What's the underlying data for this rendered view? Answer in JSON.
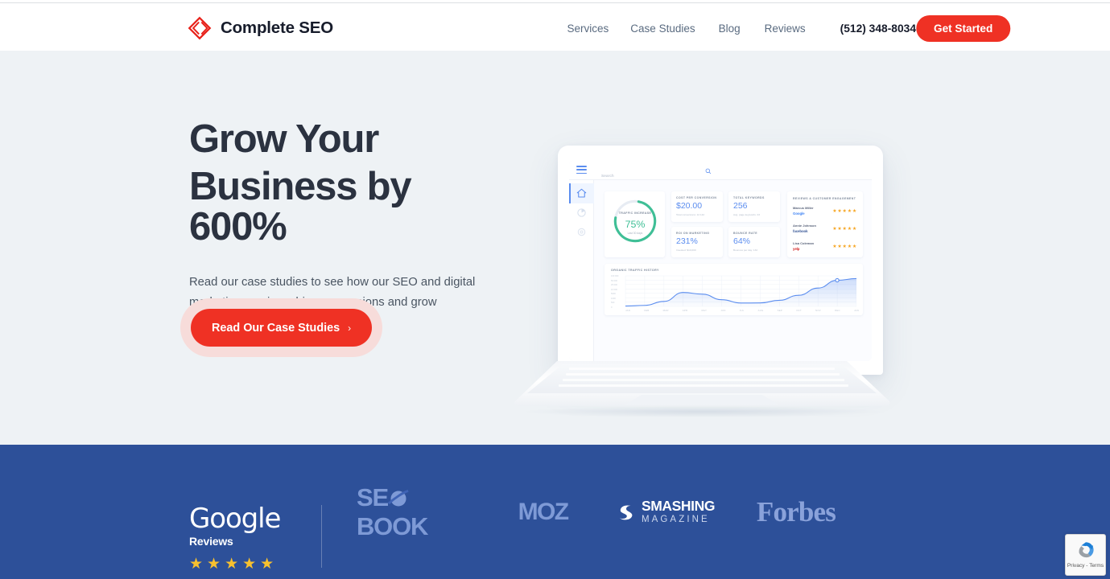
{
  "header": {
    "brand": {
      "name": "Complete SEO",
      "logo_icon": "diamond-chevron-logo",
      "color": "#ef3124"
    },
    "nav": [
      {
        "label": "Services"
      },
      {
        "label": "Case Studies"
      },
      {
        "label": "Blog"
      },
      {
        "label": "Reviews"
      }
    ],
    "phone": "(512) 348-8034",
    "cta": {
      "label": "Get Started",
      "color": "#ef3124"
    }
  },
  "hero": {
    "title_line1": "Grow Your",
    "title_line2": "Business by 600%",
    "subtitle": "Read our case studies to see how our SEO and digital marketing services drive conversions and grow businesses just like yours.",
    "cta": {
      "label": "Read Our Case Studies",
      "chevron": "›",
      "color": "#ef3124",
      "halo_color": "#f7dcda"
    },
    "background": "#eef2f5"
  },
  "dashboard": {
    "search_placeholder": "Search",
    "sidebar_icons": [
      "hamburger-icon",
      "home-icon",
      "pie-chart-icon",
      "gear-icon"
    ],
    "traffic_card": {
      "label": "TRAFFIC INCREASE",
      "value": "75%",
      "sub": "Last 30 days",
      "arc_color": "#3fbf96",
      "percent": 75
    },
    "metrics": [
      {
        "title": "COST PER CONVERSION",
        "value": "$20.00",
        "sub": "Total conversions: 12 142"
      },
      {
        "title": "TOTAL KEYWORDS",
        "value": "256",
        "sub": "Avg. page keywords: 43"
      },
      {
        "title": "ROI ON MARKETING",
        "value": "231%",
        "sub": "Invested: $10,000"
      },
      {
        "title": "BOUNCE RATE",
        "value": "64%",
        "sub": "Bounces per day: 132"
      }
    ],
    "reviews": {
      "title": "REVIEWS & CUSTOMER ENGAGEMENT",
      "items": [
        {
          "name": "Marcus Miller",
          "source": "Google",
          "source_color": "#4285f4",
          "stars": "★★★★★"
        },
        {
          "name": "Annie Johnson",
          "source": "facebook",
          "source_color": "#3b5998",
          "stars": "★★★★★"
        },
        {
          "name": "Lisa Coleman",
          "source": "yelp",
          "source_color": "#d32323",
          "stars": "★★★★★"
        }
      ]
    },
    "chart_data": {
      "type": "line",
      "title": "ORGANIC TRAFFIC HISTORY",
      "xlabel": "",
      "ylabel": "",
      "categories": [
        "JAN",
        "FEB",
        "MAR",
        "APR",
        "MAY",
        "JUN",
        "JUL",
        "AUG",
        "SEP",
        "OCT",
        "NOV",
        "DEC",
        "JAN"
      ],
      "ytick_labels": [
        "100 000",
        "50 000",
        "25 000",
        "10 000",
        "5000",
        "1000",
        "500",
        "0"
      ],
      "values": [
        600,
        1800,
        9000,
        25000,
        22000,
        12000,
        6000,
        6200,
        11000,
        20000,
        33000,
        47000,
        50000
      ],
      "ylim": [
        0,
        100000
      ],
      "grid": true,
      "line_color": "#5b8def",
      "area_fill": "#5b8def",
      "marker_index": 11,
      "legend": "none"
    }
  },
  "band": {
    "google_reviews": {
      "word": "Google",
      "subtitle": "Reviews",
      "stars": "★★★★★",
      "star_color": "#f7c12f"
    },
    "logos": [
      {
        "name": "SEOBOOK",
        "text": "SE",
        "text2": "BOOK"
      },
      {
        "name": "MOZ",
        "text": "MOZ"
      },
      {
        "name": "SMASHING MAGAZINE",
        "line1": "SMASHING",
        "line2": "MAGAZINE"
      },
      {
        "name": "Forbes",
        "text": "Forbes"
      }
    ],
    "background": "#2d5099"
  },
  "recaptcha": {
    "label": "Privacy - Terms",
    "icon": "recaptcha-icon"
  }
}
